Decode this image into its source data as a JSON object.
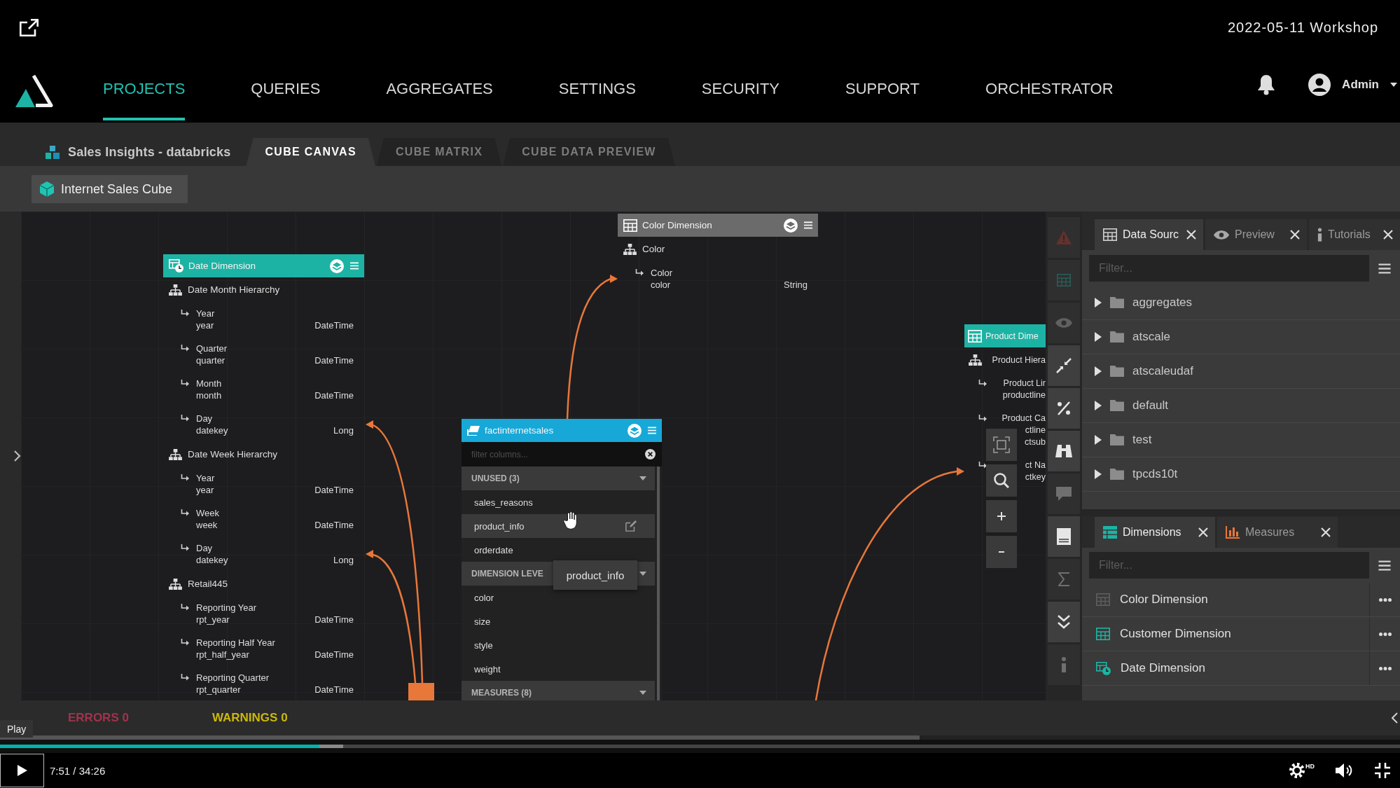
{
  "header": {
    "title": "2022-05-11 Workshop"
  },
  "nav": {
    "items": [
      {
        "label": "PROJECTS",
        "selected": true
      },
      {
        "label": "QUERIES",
        "selected": false
      },
      {
        "label": "AGGREGATES",
        "selected": false
      },
      {
        "label": "SETTINGS",
        "selected": false
      },
      {
        "label": "SECURITY",
        "selected": false
      },
      {
        "label": "SUPPORT",
        "selected": false
      },
      {
        "label": "ORCHESTRATOR",
        "selected": false
      }
    ],
    "user": "Admin"
  },
  "project": {
    "name": "Sales Insights - databricks",
    "tabs": [
      {
        "label": "CUBE CANVAS",
        "selected": true
      },
      {
        "label": "CUBE MATRIX",
        "selected": false
      },
      {
        "label": "CUBE DATA PREVIEW",
        "selected": false
      }
    ],
    "cube": "Internet Sales Cube"
  },
  "canvas": {
    "tables": [
      {
        "kind": "dimension",
        "title": "Date Dimension",
        "color": "#1db3a4",
        "partially_hidden": false,
        "items": [
          {
            "kind": "hierarchy",
            "label": "Date Month Hierarchy"
          },
          {
            "kind": "level",
            "lines": [
              "Year",
              "year"
            ],
            "type": "DateTime"
          },
          {
            "kind": "level",
            "lines": [
              "Quarter",
              "quarter"
            ],
            "type": "DateTime"
          },
          {
            "kind": "level",
            "lines": [
              "Month",
              "month"
            ],
            "type": "DateTime"
          },
          {
            "kind": "level",
            "lines": [
              "Day",
              "datekey"
            ],
            "type": "Long"
          },
          {
            "kind": "hierarchy",
            "label": "Date Week Hierarchy"
          },
          {
            "kind": "level",
            "lines": [
              "Year",
              "year"
            ],
            "type": "DateTime"
          },
          {
            "kind": "level",
            "lines": [
              "Week",
              "week"
            ],
            "type": "DateTime"
          },
          {
            "kind": "level",
            "lines": [
              "Day",
              "datekey"
            ],
            "type": "Long"
          },
          {
            "kind": "hierarchy",
            "label": "Retail445"
          },
          {
            "kind": "level",
            "lines": [
              "Reporting Year",
              "rpt_year"
            ],
            "type": "DateTime"
          },
          {
            "kind": "level",
            "lines": [
              "Reporting Half Year",
              "rpt_half_year"
            ],
            "type": "DateTime"
          },
          {
            "kind": "level",
            "lines": [
              "Reporting Quarter",
              "rpt_quarter"
            ],
            "type": "DateTime"
          }
        ]
      },
      {
        "kind": "dimension",
        "title": "Color Dimension",
        "color": "#6b6b6b",
        "partially_hidden": false,
        "items": [
          {
            "kind": "hierarchy",
            "label": "Color"
          },
          {
            "kind": "level",
            "lines": [
              "Color",
              "color"
            ],
            "type": "String"
          }
        ]
      },
      {
        "kind": "fact",
        "title": "factinternetsales",
        "color": "#18a8d8",
        "filter_placeholder": "filter columns...",
        "sections": [
          {
            "title": "UNUSED (3)",
            "expanded": true,
            "columns": [
              {
                "name": "sales_reasons",
                "highlighted": false
              },
              {
                "name": "product_info",
                "highlighted": true
              },
              {
                "name": "orderdate",
                "highlighted": false
              }
            ]
          },
          {
            "title": "DIMENSION LEVE",
            "expanded": true,
            "columns": [
              {
                "name": "color",
                "highlighted": false
              },
              {
                "name": "size",
                "highlighted": false
              },
              {
                "name": "style",
                "highlighted": false
              },
              {
                "name": "weight",
                "highlighted": false
              }
            ]
          },
          {
            "title": "MEASURES (8)",
            "expanded": true
          }
        ]
      },
      {
        "kind": "dimension",
        "title": "Product Dime",
        "color": "#1db3a4",
        "partially_hidden": true,
        "items": [
          {
            "kind": "hierarchy",
            "label": "Product Hiera"
          },
          {
            "kind": "level",
            "lines": [
              "Product Lir",
              "productline"
            ]
          },
          {
            "kind": "level",
            "lines": [
              "Product Ca",
              "ctline",
              "ctsub"
            ]
          },
          {
            "kind": "level",
            "lines": [
              "ct Na",
              "ctkey"
            ]
          }
        ]
      }
    ],
    "tooltip": "product_info"
  },
  "toolbar": {
    "tools": [
      {
        "kind": "warning",
        "disabled": true
      },
      {
        "kind": "table",
        "disabled": true
      },
      {
        "kind": "eye",
        "disabled": true
      },
      {
        "kind": "pin",
        "disabled": false
      },
      {
        "kind": "percent",
        "disabled": false
      },
      {
        "kind": "binoculars",
        "disabled": false
      },
      {
        "kind": "comment",
        "disabled": true
      },
      {
        "kind": "book",
        "disabled": false
      },
      {
        "kind": "sigma",
        "disabled": true
      },
      {
        "kind": "chevrons",
        "disabled": false
      },
      {
        "kind": "info",
        "disabled": true
      }
    ]
  },
  "data_panel": {
    "tabs": [
      {
        "label": "Data Sourc",
        "selected": true
      },
      {
        "label": "Preview",
        "selected": false
      },
      {
        "label": "Tutorials",
        "selected": false
      }
    ],
    "filter_placeholder": "Filter...",
    "folders": [
      {
        "name": "aggregates",
        "expanded": false
      },
      {
        "name": "atscale",
        "expanded": false
      },
      {
        "name": "atscaleudaf",
        "expanded": false
      },
      {
        "name": "default",
        "expanded": false
      },
      {
        "name": "test",
        "expanded": false
      },
      {
        "name": "tpcds10t",
        "expanded": false
      }
    ]
  },
  "dimension_panel": {
    "tabs": [
      {
        "label": "Dimensions",
        "selected": true
      },
      {
        "label": "Measures",
        "selected": false
      }
    ],
    "filter_placeholder": "Filter...",
    "items": [
      {
        "name": "Color Dimension",
        "color": "#5e5e5e"
      },
      {
        "name": "Customer Dimension",
        "color": "#1db3a4"
      },
      {
        "name": "Date Dimension",
        "color": "#1db3a4"
      }
    ]
  },
  "status_bar": {
    "errors": "ERRORS 0",
    "warnings": "WARNINGS 0"
  },
  "player": {
    "tooltip": "Play",
    "progress": {
      "level": 0.228
    },
    "buffer": {
      "level": 0.245
    },
    "time": "7:51 / 34:26",
    "quality": "HD"
  }
}
